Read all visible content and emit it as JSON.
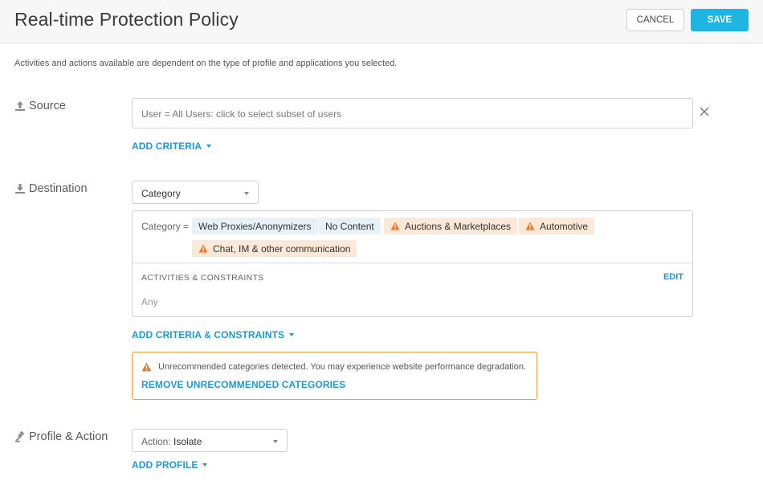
{
  "header": {
    "title": "Real-time Protection Policy",
    "cancel_label": "CANCEL",
    "save_label": "SAVE"
  },
  "subtitle": "Activities and actions available are dependent on the type of profile and applications you selected.",
  "source": {
    "label": "Source",
    "icon": "upload-icon",
    "user_field_value": "User = All Users: click to select subset of users",
    "add_criteria_label": "ADD CRITERIA"
  },
  "destination": {
    "label": "Destination",
    "icon": "download-icon",
    "type_select_value": "Category",
    "category_prefix": "Category =",
    "categories": [
      {
        "label": "Web Proxies/Anonymizers",
        "warning": false
      },
      {
        "label": "No Content",
        "warning": false
      },
      {
        "label": "Auctions & Marketplaces",
        "warning": true
      },
      {
        "label": "Automotive",
        "warning": true
      },
      {
        "label": "Chat, IM & other communication",
        "warning": true
      }
    ],
    "activities_title": "ACTIVITIES & CONSTRAINTS",
    "activities_edit_label": "EDIT",
    "activities_value": "Any",
    "add_criteria_constraints_label": "ADD CRITERIA & CONSTRAINTS"
  },
  "warning": {
    "message": "Unrecommended categories detected. You may experience website performance degradation.",
    "remove_label": "REMOVE UNRECOMMENDED CATEGORIES"
  },
  "profile_action": {
    "label": "Profile & Action",
    "icon": "gavel-icon",
    "action_prefix": "Action:",
    "action_value": "Isolate",
    "add_profile_label": "ADD PROFILE"
  },
  "colors": {
    "accent": "#1a9bd7",
    "save_button": "#1fb5e3",
    "warning_border": "#f09c43",
    "warning_icon": "#e8792b",
    "chip_blue": "#e6f1f8",
    "chip_warn": "#fce8d6"
  }
}
